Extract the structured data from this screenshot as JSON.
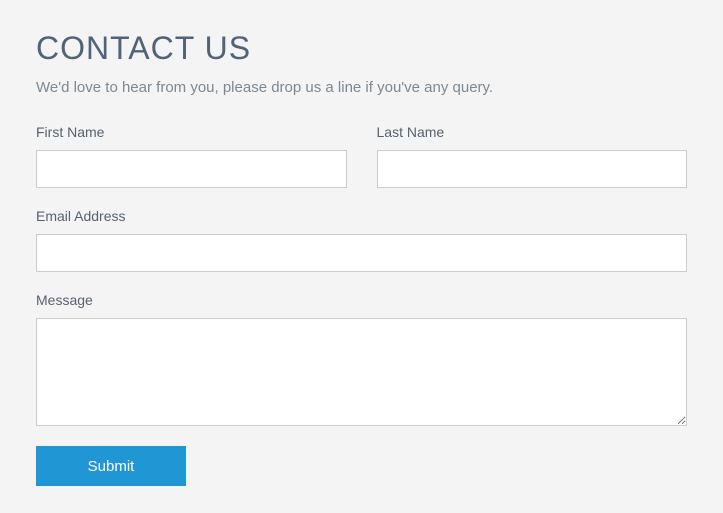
{
  "header": {
    "title": "CONTACT US",
    "subtitle": "We'd love to hear from you, please drop us a line if you've any query."
  },
  "form": {
    "first_name": {
      "label": "First Name",
      "value": ""
    },
    "last_name": {
      "label": "Last Name",
      "value": ""
    },
    "email": {
      "label": "Email Address",
      "value": ""
    },
    "message": {
      "label": "Message",
      "value": ""
    },
    "submit_label": "Submit"
  }
}
